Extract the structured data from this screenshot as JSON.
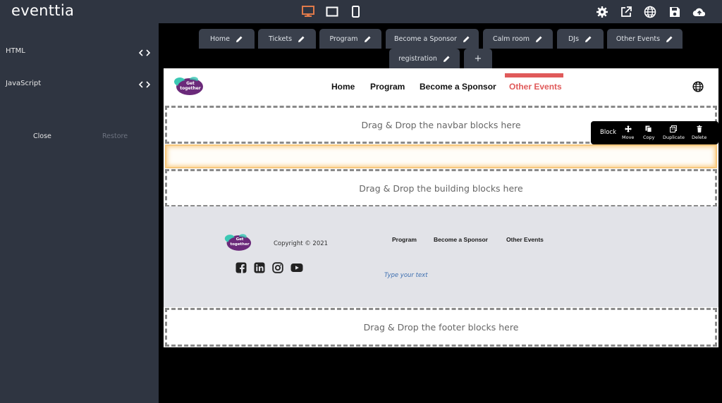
{
  "app": {
    "logo_text": "eventtia"
  },
  "devices": [
    "desktop",
    "tablet",
    "mobile"
  ],
  "actions": [
    "settings",
    "open-external",
    "language",
    "save",
    "publish"
  ],
  "sidebar": {
    "html_label": "HTML",
    "js_label": "JavaScript",
    "close_label": "Close",
    "restore_label": "Restore"
  },
  "page_tabs": [
    "Home",
    "Tickets",
    "Program",
    "Become a Sponsor",
    "Calm room",
    "DJs",
    "Other Events",
    "registration"
  ],
  "add_tab_label": "+",
  "site": {
    "logo_text": "Get together",
    "nav": [
      "Home",
      "Program",
      "Become a Sponsor",
      "Other Events"
    ],
    "active_nav": "Other Events",
    "accent": "#e05a5a"
  },
  "dropzones": {
    "navbar": "Drag & Drop the navbar blocks here",
    "building": "Drag & Drop the building blocks here",
    "footer": "Drag & Drop the footer blocks here"
  },
  "block_toolbar": {
    "title": "Block",
    "move": "Move",
    "copy": "Copy",
    "duplicate": "Duplicate",
    "delete": "Delete"
  },
  "footer": {
    "copyright": "Copyright © 2021",
    "links": [
      "Program",
      "Become a Sponsor",
      "Other Events"
    ],
    "placeholder_text": "Type your text",
    "socials": [
      "facebook",
      "linkedin",
      "instagram",
      "youtube"
    ]
  },
  "colors": {
    "chrome": "#2f3541",
    "tab": "#3a404c",
    "brand_purple": "#6b2a7a",
    "brand_teal": "#3cc8b4",
    "device_active": "#e07a4a"
  }
}
